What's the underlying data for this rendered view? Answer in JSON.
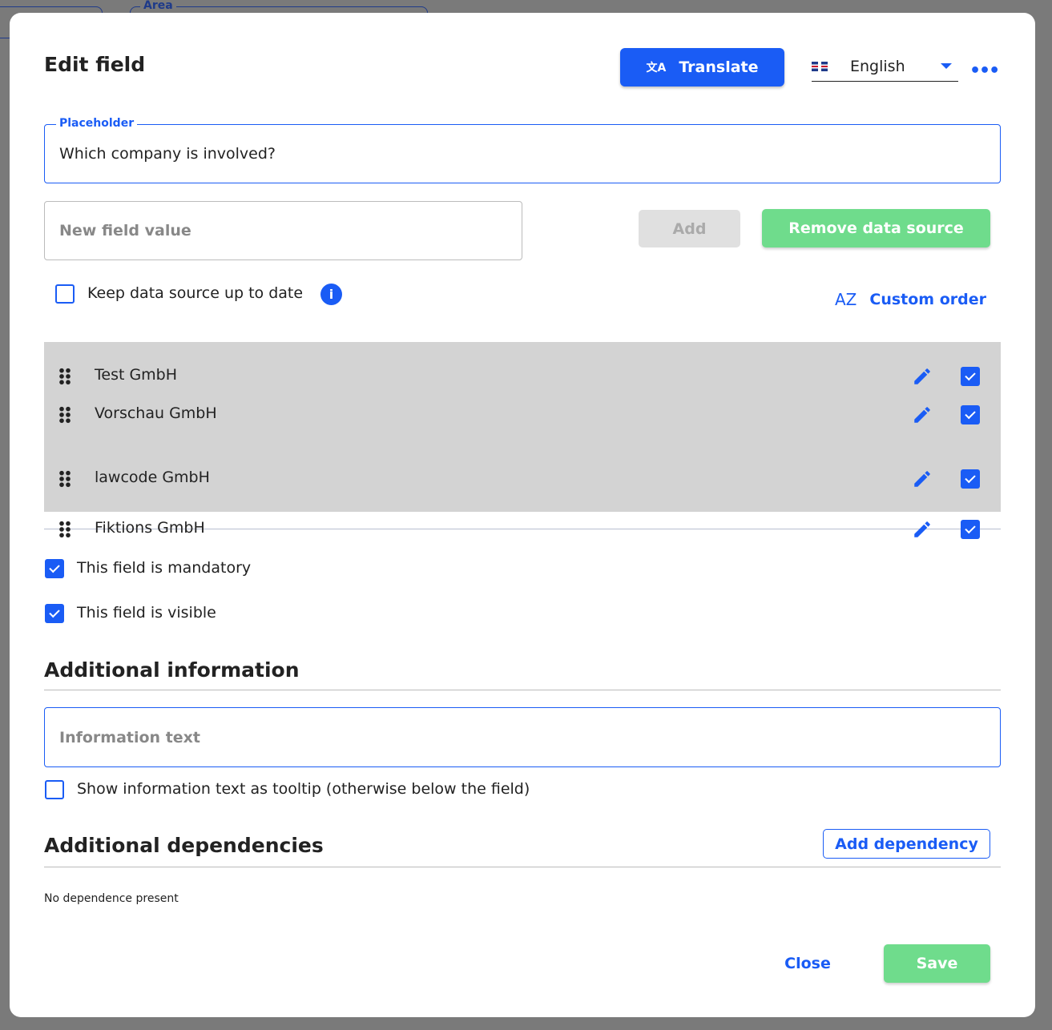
{
  "background": {
    "area_label": "Area"
  },
  "header": {
    "title": "Edit field",
    "translate_label": "Translate",
    "language": "English"
  },
  "placeholder_field": {
    "label": "Placeholder",
    "value": "Which company is involved?"
  },
  "new_value": {
    "placeholder": "New field value",
    "add_label": "Add",
    "remove_label": "Remove data source"
  },
  "keep_up_to_date": {
    "label": "Keep data source up to date",
    "checked": false
  },
  "custom_order": {
    "label": "Custom order"
  },
  "values": [
    {
      "label": "Test GmbH",
      "checked": true
    },
    {
      "label": "Vorschau GmbH",
      "checked": true
    },
    {
      "label": "lawcode GmbH",
      "checked": true
    },
    {
      "label": "Fiktions GmbH",
      "checked": true
    }
  ],
  "mandatory": {
    "label": "This field is mandatory",
    "checked": true
  },
  "visible": {
    "label": "This field is visible",
    "checked": true
  },
  "additional_info": {
    "title": "Additional information",
    "placeholder": "Information text",
    "tooltip_label": "Show information text as tooltip (otherwise below the field)",
    "tooltip_checked": false
  },
  "dependencies": {
    "title": "Additional dependencies",
    "add_label": "Add dependency",
    "empty_text": "No dependence present"
  },
  "footer": {
    "close_label": "Close",
    "save_label": "Save"
  },
  "colors": {
    "primary": "#1a5cf5",
    "success": "#6fdc8c",
    "disabled": "#e0e0e0"
  }
}
